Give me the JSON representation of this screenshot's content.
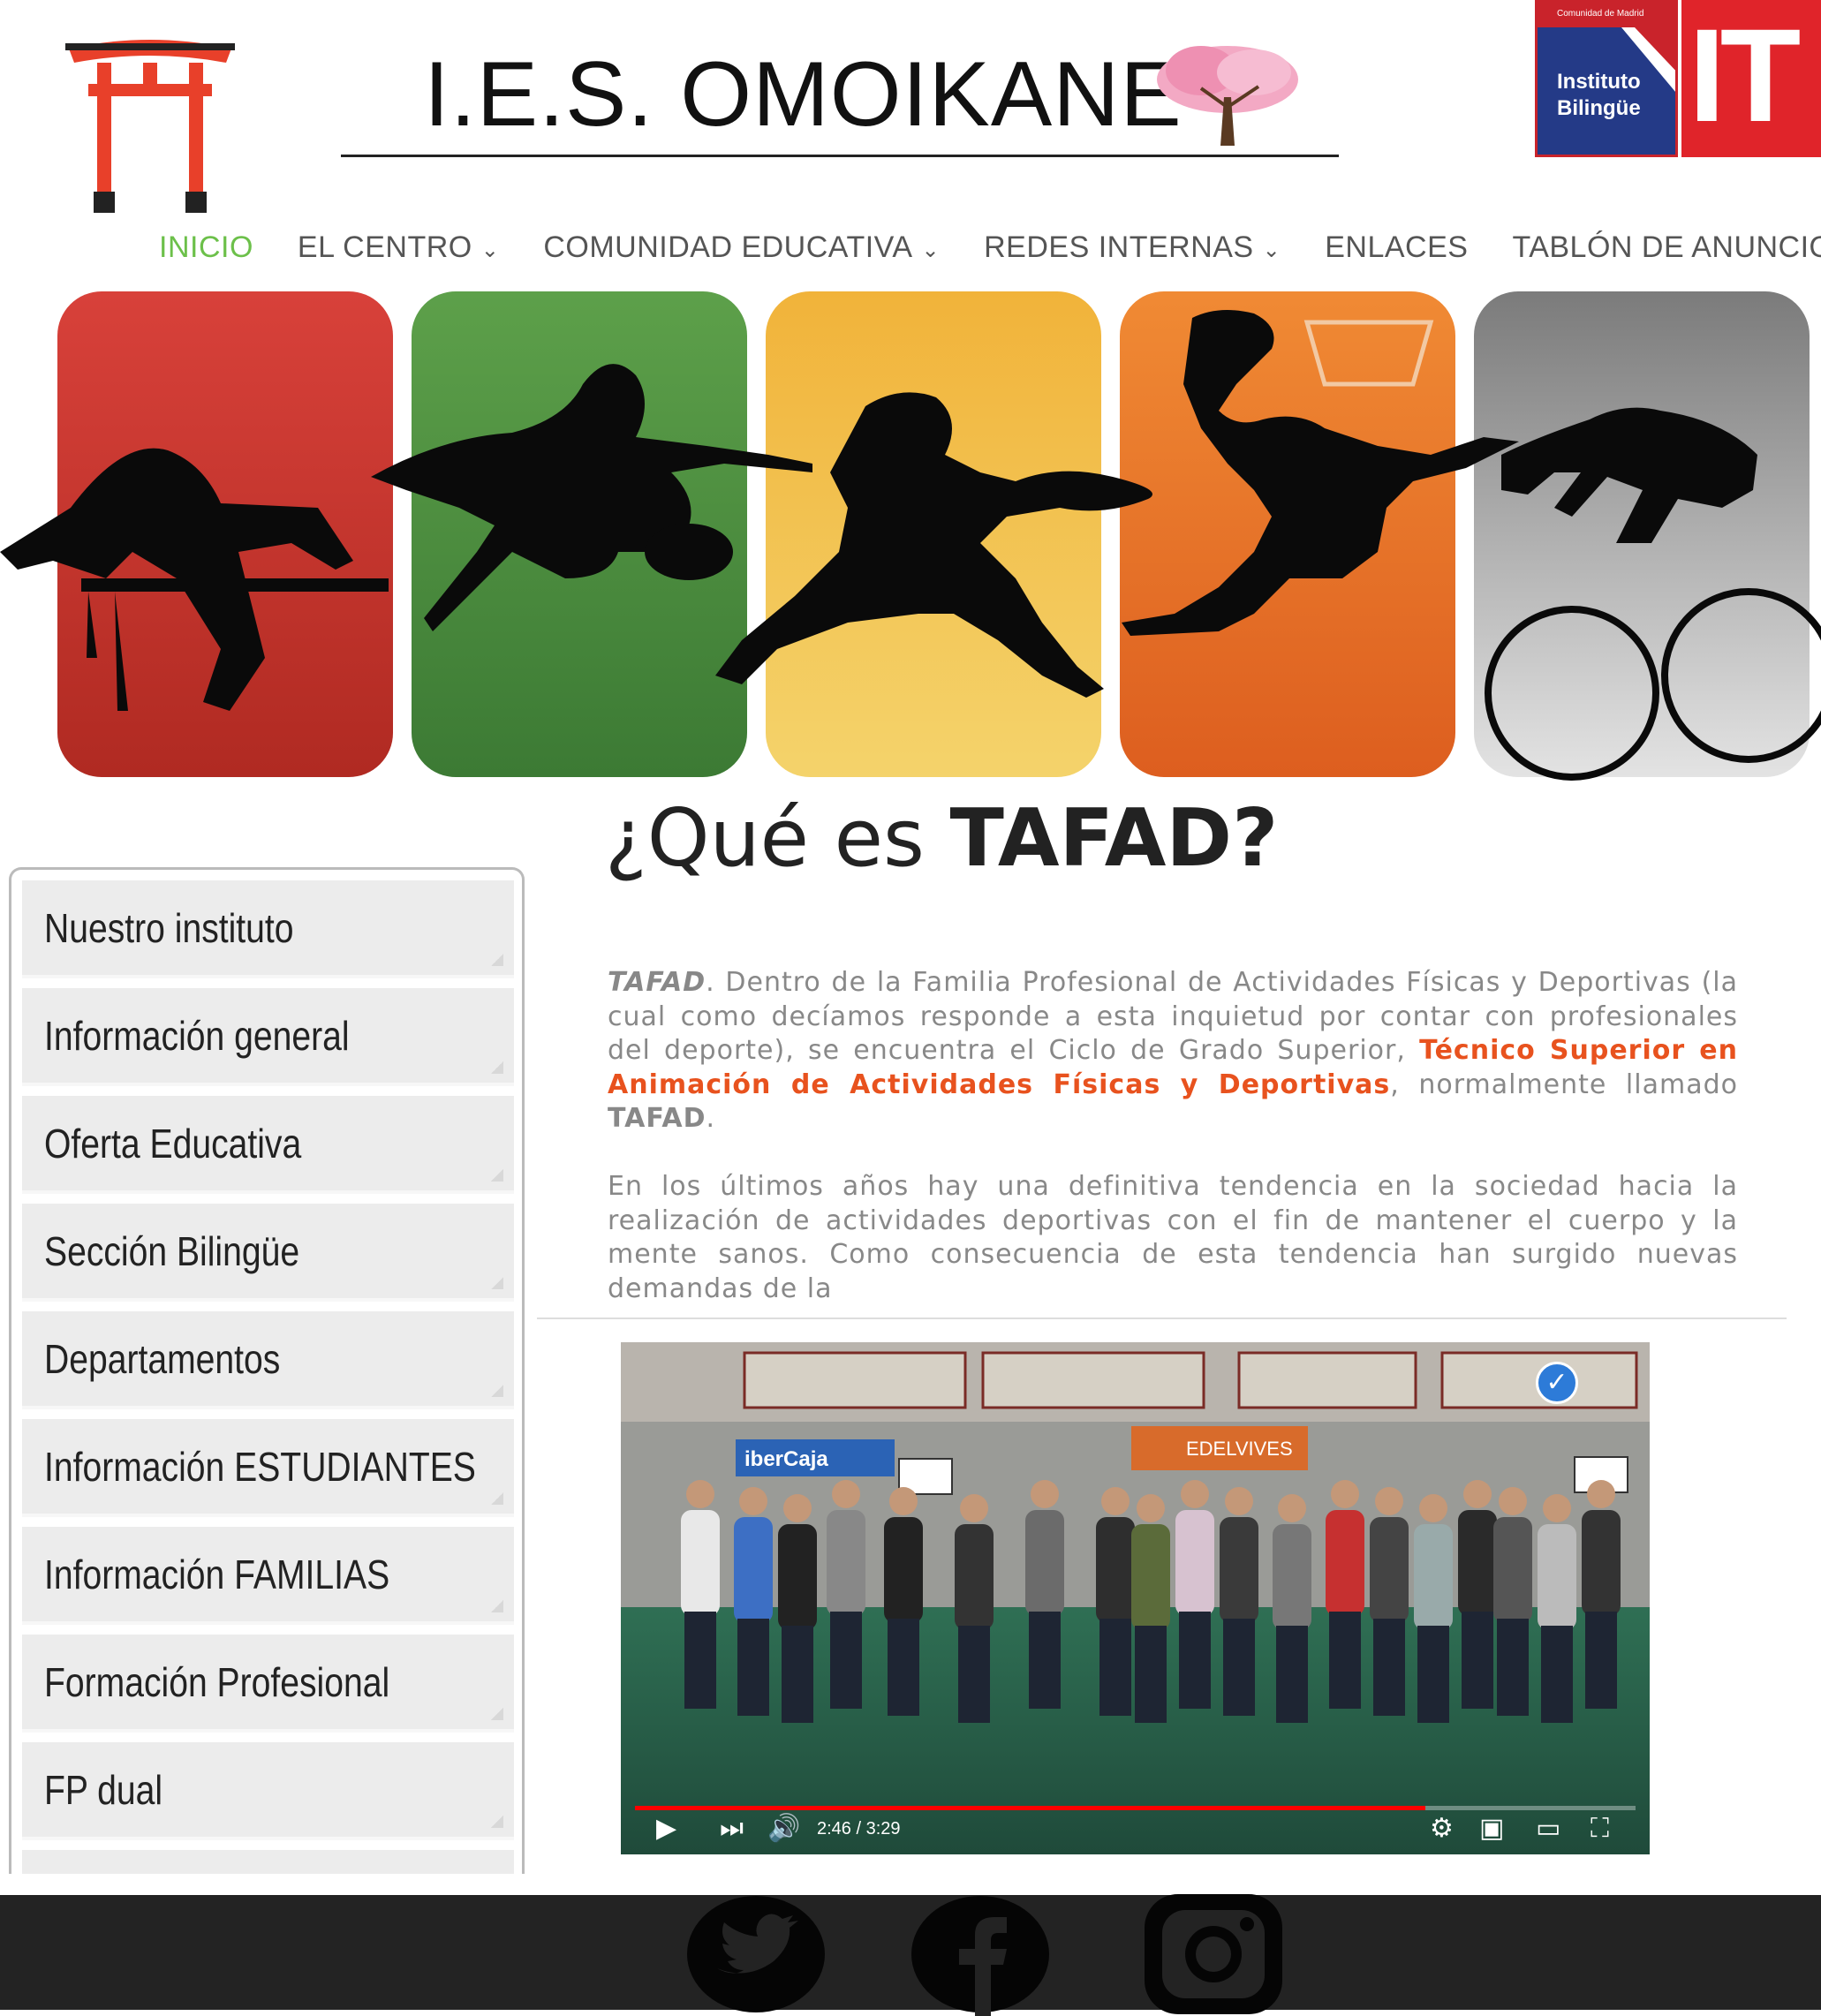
{
  "header": {
    "title": "I.E.S. OMOIKANE",
    "badge_text": "Instituto\nBilingüe",
    "badge_top_text": "Comunidad de Madrid",
    "it_logo_text": "IT"
  },
  "nav": {
    "items": [
      {
        "label": "INICIO",
        "active": true,
        "has_dropdown": false
      },
      {
        "label": "EL CENTRO",
        "active": false,
        "has_dropdown": true
      },
      {
        "label": "COMUNIDAD EDUCATIVA",
        "active": false,
        "has_dropdown": true
      },
      {
        "label": "REDES INTERNAS",
        "active": false,
        "has_dropdown": true
      },
      {
        "label": "ENLACES",
        "active": false,
        "has_dropdown": false
      },
      {
        "label": "TABLÓN DE ANUNCIOS",
        "active": false,
        "has_dropdown": false
      }
    ],
    "caret": "⌄"
  },
  "banner": {
    "panels": [
      {
        "sport": "hurdles",
        "colors": [
          "#d8413a",
          "#b02a22"
        ]
      },
      {
        "sport": "football",
        "colors": [
          "#5da04a",
          "#3c7a34"
        ]
      },
      {
        "sport": "tennis",
        "colors": [
          "#f1b33a",
          "#f4d36b"
        ]
      },
      {
        "sport": "basketball",
        "colors": [
          "#f08a34",
          "#dd5e1f"
        ]
      },
      {
        "sport": "cycling",
        "colors": [
          "#7b7b7b",
          "#e3e3e3"
        ]
      }
    ]
  },
  "sidebar": {
    "items": [
      {
        "label": "Nuestro instituto"
      },
      {
        "label": "Información general"
      },
      {
        "label": "Oferta Educativa"
      },
      {
        "label": "Sección Bilingüe"
      },
      {
        "label": "Departamentos"
      },
      {
        "label": "Información ESTUDIANTES"
      },
      {
        "label": "Información FAMILIAS"
      },
      {
        "label": "Formación Profesional"
      },
      {
        "label": "FP dual"
      }
    ]
  },
  "main": {
    "heading_pre": "¿Qué es ",
    "heading_strong": "TAFAD?",
    "p1_em": "TAFAD",
    "p1_a": ". Dentro de la Familia Profesional de Actividades Físicas y Deportivas (la cual como decíamos responde a esta inquietud por contar con profesionales del deporte), se encuentra el Ciclo de Grado Superior, ",
    "p1_highlight": "Técnico Superior en Animación de Actividades Físicas y Deportivas",
    "p1_b": ", normalmente llamado ",
    "p1_strong": "TAFAD",
    "p1_end": ".",
    "p2": "En los últimos años hay una definitiva tendencia en la sociedad hacia la realización de actividades deportivas con el fin de mantener el cuerpo y la mente sanos. Como consecuencia de esta tendencia han surgido nuevas demandas de la"
  },
  "video": {
    "time": "2:46 / 3:29",
    "progress": 0.79,
    "sponsor_left": "iberCaja",
    "sponsor_right": "EDELVIVES",
    "icons": [
      "play-icon",
      "next-icon",
      "volume-icon",
      "settings-icon",
      "miniplayer-icon",
      "theater-icon",
      "fullscreen-icon"
    ]
  },
  "footer": {
    "social": [
      "twitter-icon",
      "facebook-icon",
      "instagram-icon"
    ]
  },
  "colors": {
    "nav_active": "#6cc04a",
    "nav_text": "#555555",
    "highlight": "#e8521e",
    "footer_bg": "#232323",
    "progress": "#ff0000"
  }
}
